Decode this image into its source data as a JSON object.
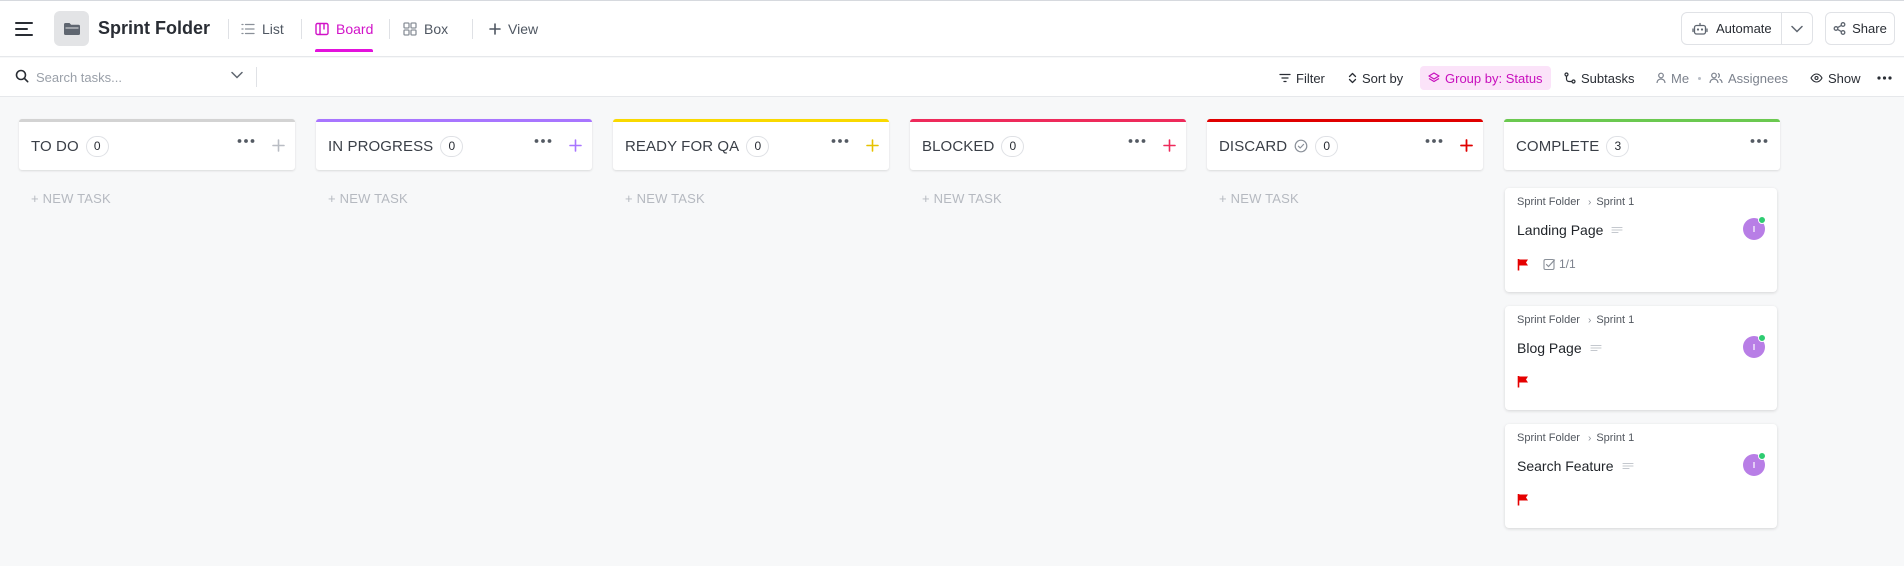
{
  "header": {
    "title": "Sprint Folder",
    "tabs": [
      {
        "label": "List",
        "icon": "list-icon"
      },
      {
        "label": "Board",
        "icon": "board-icon",
        "active": true
      },
      {
        "label": "Box",
        "icon": "box-icon"
      }
    ],
    "add_view_label": "View",
    "automate_label": "Automate",
    "share_label": "Share"
  },
  "toolbar": {
    "search_placeholder": "Search tasks...",
    "filter_label": "Filter",
    "sort_label": "Sort by",
    "group_label": "Group by: Status",
    "subtasks_label": "Subtasks",
    "me_label": "Me",
    "assignees_label": "Assignees",
    "show_label": "Show"
  },
  "colors": {
    "accent": "#d112c8",
    "todo": "#d3d3d3",
    "in_progress": "#a875ff",
    "ready_for_qa": "#f9d900",
    "blocked": "#ee2a5b",
    "discard": "#e00000",
    "complete": "#6bc950",
    "priority_flag": "#e50000"
  },
  "columns": [
    {
      "name": "TO DO",
      "count": "0",
      "new_task": "+ NEW TASK"
    },
    {
      "name": "IN PROGRESS",
      "count": "0",
      "new_task": "+ NEW TASK"
    },
    {
      "name": "READY FOR QA",
      "count": "0",
      "new_task": "+ NEW TASK"
    },
    {
      "name": "BLOCKED",
      "count": "0",
      "new_task": "+ NEW TASK"
    },
    {
      "name": "DISCARD",
      "count": "0",
      "new_task": "+ NEW TASK"
    },
    {
      "name": "COMPLETE",
      "count": "3"
    }
  ],
  "cards": [
    {
      "folder": "Sprint Folder",
      "list": "Sprint 1",
      "title": "Landing Page",
      "subtasks": "1/1"
    },
    {
      "folder": "Sprint Folder",
      "list": "Sprint 1",
      "title": "Blog Page"
    },
    {
      "folder": "Sprint Folder",
      "list": "Sprint 1",
      "title": "Search Feature"
    }
  ]
}
